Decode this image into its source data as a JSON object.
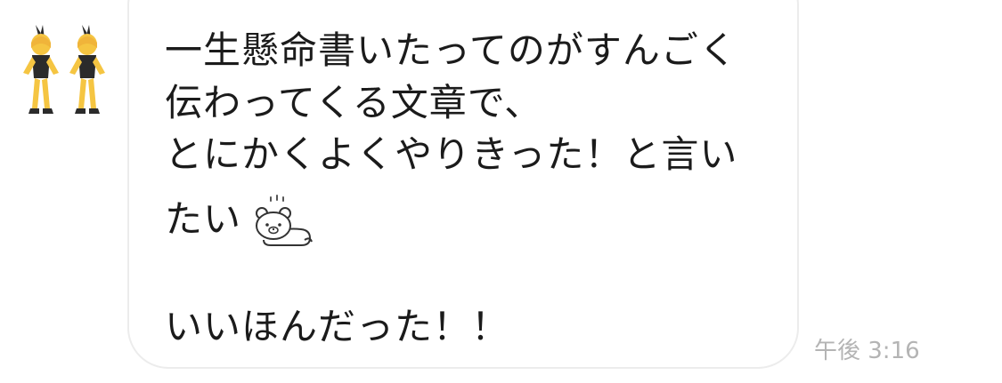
{
  "message": {
    "avatar_icon": "bunny-dancers-emoji-icon",
    "lines": [
      "一生懸命書いたってのがすんごく",
      "伝わってくる文章で、",
      "とにかくよくやりきった！と言い",
      "たい",
      "いいほんだった！！"
    ],
    "sticker_icon": "lying-bear-sticker-icon",
    "time": "午後 3:16"
  },
  "colors": {
    "text": "#1b1b1b",
    "bubble_border": "#ececec",
    "timestamp": "#b4b4b4",
    "emoji_skin": "#f5c542",
    "emoji_suit": "#2b2b2b"
  }
}
